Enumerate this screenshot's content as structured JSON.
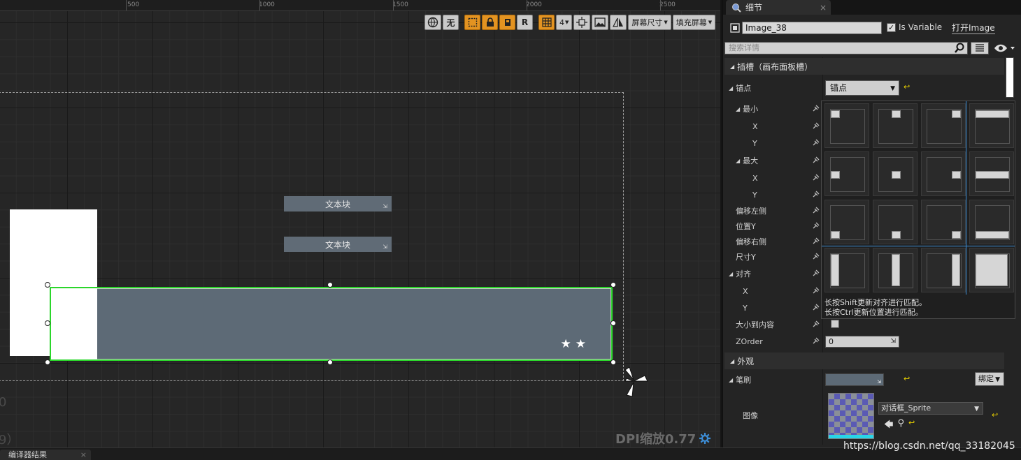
{
  "ruler": {
    "labels": [
      "500",
      "1000",
      "1500",
      "2000",
      "2500"
    ]
  },
  "toolbar": {
    "none_label": "无",
    "r_label": "R",
    "grid_num": "4",
    "screen_size": "屏幕尺寸",
    "fill_screen": "填充屏幕"
  },
  "canvas": {
    "text_block_1": "文本块",
    "text_block_2": "文本块",
    "left_zero": "0",
    "left_paren": "9）",
    "dpi": "DPI缩放0.77"
  },
  "bottom": {
    "tab_label": "编译器结果"
  },
  "details": {
    "tab_title": "细节",
    "widget_name": "Image_38",
    "is_variable_label": "Is Variable",
    "is_variable": true,
    "open_image": "打开Image",
    "search_placeholder": "搜索详情",
    "section_slot": "插槽（画布面板槽）",
    "anchor_label": "锚点",
    "anchor_value": "锚点",
    "min_label": "最小",
    "x_label": "X",
    "y_label": "Y",
    "max_label": "最大",
    "offset_left": "偏移左侧",
    "position_y": "位置Y",
    "offset_right": "偏移右侧",
    "size_y": "尺寸Y",
    "alignment": "对齐",
    "size_to_content": "大小到内容",
    "zorder_label": "ZOrder",
    "zorder_value": "0",
    "hint_shift": "长按Shift更新对齐进行匹配。",
    "hint_ctrl": "长按Ctrl更新位置进行匹配。",
    "section_appearance": "外观",
    "brush_label": "笔刷",
    "bind_label": "绑定",
    "image_label": "图像",
    "sprite_name": "对话框_Sprite"
  },
  "watermark": "https://blog.csdn.net/qq_33182045",
  "colors": {
    "selection": "#2bd62b",
    "toolbar_active": "#e39321",
    "brush_tint": "#5d6a76",
    "anchor_blue": "#3d8fd9"
  }
}
